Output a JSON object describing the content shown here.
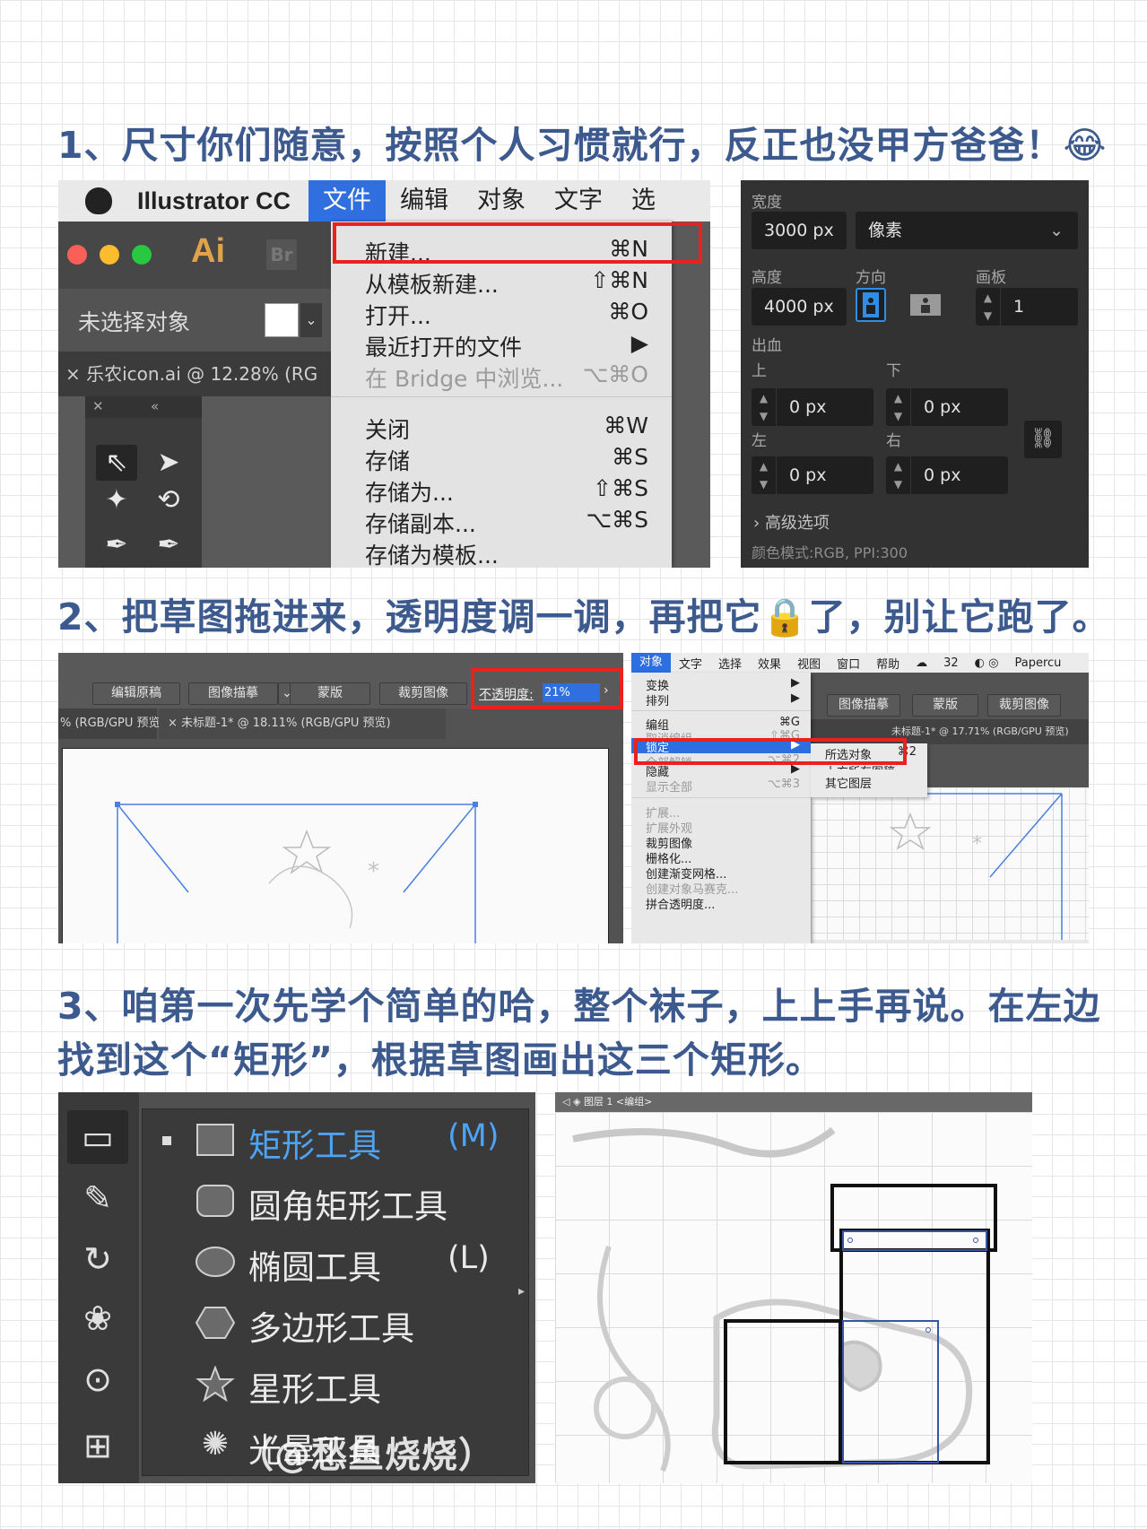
{
  "headings": {
    "step1": "1、尺寸你们随意，按照个人习惯就行，反正也没甲方爸爸！😂",
    "step2": "2、把草图拖进来，透明度调一调，再把它🔒了，别让它跑了。",
    "step3_line1": "3、咱第一次先学个简单的哈，整个袜子，上上手再说。在左边",
    "step3_line2": "找到这个“矩形”，根据草图画出这三个矩形。"
  },
  "panel1": {
    "menubar": {
      "app": "Illustrator CC",
      "items": [
        "文件",
        "编辑",
        "对象",
        "文字",
        "选"
      ],
      "active_index": 0
    },
    "ai_logo": "Ai",
    "br_logo": "Br",
    "control_label": "未选择对象",
    "doc_tab": "×  乐农icon.ai @ 12.28% (RG",
    "file_menu": [
      {
        "label": "新建...",
        "shortcut": "⌘N",
        "highlight": true
      },
      {
        "label": "从模板新建...",
        "shortcut": "⇧⌘N"
      },
      {
        "label": "打开...",
        "shortcut": "⌘O"
      },
      {
        "label": "最近打开的文件",
        "shortcut": "▶"
      },
      {
        "label": "在 Bridge 中浏览...",
        "shortcut": "⌥⌘O",
        "disabled": true
      },
      {
        "label": "关闭",
        "shortcut": "⌘W"
      },
      {
        "label": "存储",
        "shortcut": "⌘S"
      },
      {
        "label": "存储为...",
        "shortcut": "⇧⌘S"
      },
      {
        "label": "存储副本...",
        "shortcut": "⌥⌘S"
      },
      {
        "label": "存储为模板..."
      }
    ]
  },
  "new_doc": {
    "width_label": "宽度",
    "width_value": "3000 px",
    "unit": "像素",
    "height_label": "高度",
    "height_value": "4000 px",
    "orientation_label": "方向",
    "artboards_label": "画板",
    "artboards_value": "1",
    "bleed_label": "出血",
    "top_label": "上",
    "bottom_label": "下",
    "left_label": "左",
    "right_label": "右",
    "bleed_top": "0 px",
    "bleed_bottom": "0 px",
    "bleed_left": "0 px",
    "bleed_right": "0 px",
    "advanced": "高级选项",
    "color_mode": "颜色模式:RGB, PPI:300"
  },
  "panel2": {
    "buttons": [
      "编辑原稿",
      "图像描摹",
      "蒙版",
      "裁剪图像"
    ],
    "opacity_label": "不透明度:",
    "opacity_value": "21%",
    "tabs": [
      "% (RGB/GPU 预览)",
      "×  未标题-1* @ 18.11% (RGB/GPU 预览)"
    ]
  },
  "panel2b": {
    "menubar": [
      "对象",
      "文字",
      "选择",
      "效果",
      "视图",
      "窗口",
      "帮助"
    ],
    "badge": "32",
    "paper": "Papercu",
    "object_menu": [
      {
        "label": "变换",
        "shortcut": "▶"
      },
      {
        "label": "排列",
        "shortcut": "▶"
      },
      {
        "label": "编组",
        "shortcut": "⌘G"
      },
      {
        "label": "取消编组",
        "shortcut": "⇧⌘G",
        "disabled": true
      },
      {
        "label": "锁定",
        "shortcut": "▶",
        "highlight": true
      },
      {
        "label": "全部解锁",
        "shortcut": "⌥⌘2",
        "disabled": true
      },
      {
        "label": "隐藏",
        "shortcut": "▶"
      },
      {
        "label": "显示全部",
        "shortcut": "⌥⌘3",
        "disabled": true
      },
      {
        "label": "扩展...",
        "disabled": true
      },
      {
        "label": "扩展外观",
        "disabled": true
      },
      {
        "label": "裁剪图像"
      },
      {
        "label": "栅格化..."
      },
      {
        "label": "创建渐变网格..."
      },
      {
        "label": "创建对象马赛克...",
        "disabled": true
      },
      {
        "label": "拼合透明度..."
      }
    ],
    "lock_submenu": [
      {
        "label": "所选对象",
        "shortcut": "⌘2"
      },
      {
        "label": "上方所有图稿",
        "shortcut": ""
      },
      {
        "label": "其它图层",
        "shortcut": ""
      }
    ],
    "buttons": [
      "图像描摹",
      "蒙版",
      "裁剪图像"
    ],
    "tab": "未标题-1* @ 17.71% (RGB/GPU 预览)"
  },
  "panel3": {
    "flyout": [
      {
        "icon": "rectangle-icon",
        "label": "矩形工具",
        "key": "(M)"
      },
      {
        "icon": "rounded-rectangle-icon",
        "label": "圆角矩形工具",
        "key": ""
      },
      {
        "icon": "ellipse-icon",
        "label": "椭圆工具",
        "key": "(L)"
      },
      {
        "icon": "polygon-icon",
        "label": "多边形工具",
        "key": ""
      },
      {
        "icon": "star-icon",
        "label": "星形工具",
        "key": ""
      },
      {
        "icon": "flare-icon",
        "label": "光晕工具",
        "key": ""
      }
    ],
    "watermark": "（@愁鱼烧烧）",
    "breadcrumb": "图层 1  <编组>"
  }
}
